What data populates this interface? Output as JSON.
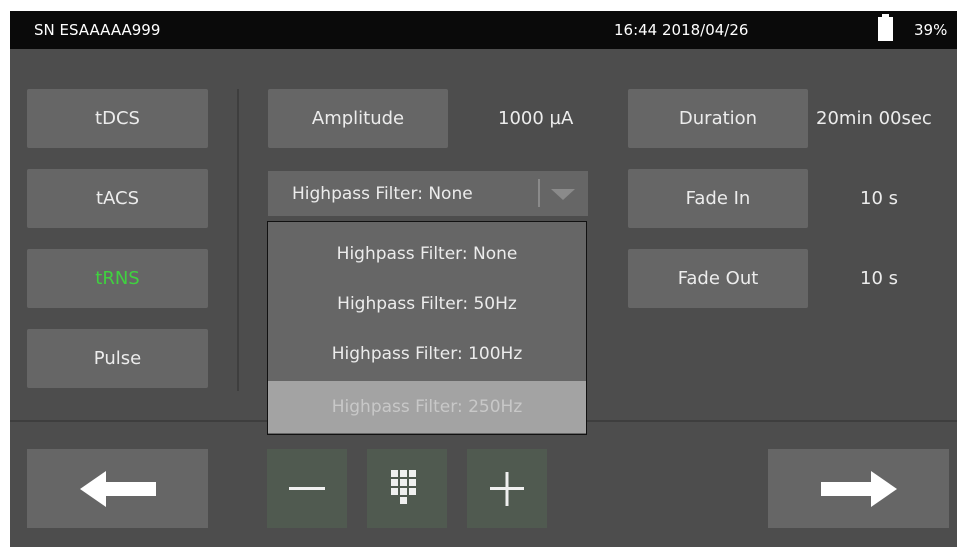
{
  "status": {
    "serial": "SN ESAAAAA999",
    "datetime": "16:44 2018/04/26",
    "battery": "39%",
    "battery_level": 0.39
  },
  "modes": [
    {
      "label": "tDCS",
      "active": false
    },
    {
      "label": "tACS",
      "active": false
    },
    {
      "label": "tRNS",
      "active": true
    },
    {
      "label": "Pulse",
      "active": false
    }
  ],
  "amplitude": {
    "label": "Amplitude",
    "value": "1000 µA"
  },
  "duration": {
    "label": "Duration",
    "value": "20min 00sec"
  },
  "fade_in": {
    "label": "Fade In",
    "value": "10 s"
  },
  "fade_out": {
    "label": "Fade Out",
    "value": "10 s"
  },
  "highpass": {
    "selected": "Highpass Filter: None",
    "options": [
      "Highpass Filter: None",
      "Highpass Filter: 50Hz",
      "Highpass Filter: 100Hz",
      "Highpass Filter: 250Hz"
    ]
  },
  "colors": {
    "active_mode": "#3fd23f",
    "background": "#4d4d4d",
    "button": "#666666"
  },
  "icons": {
    "back": "arrow-left-icon",
    "next": "arrow-right-icon",
    "minus": "minus-icon",
    "plus": "plus-icon",
    "keypad": "keypad-icon"
  }
}
